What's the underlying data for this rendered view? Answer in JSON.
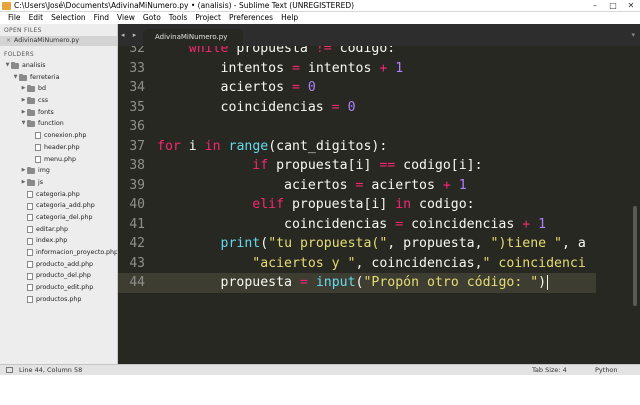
{
  "window": {
    "title": "C:\\Users\\José\\Documents\\AdivinaMiNumero.py • (analisis) - Sublime Text (UNREGISTERED)",
    "controls": [
      "–",
      "□",
      "✕"
    ]
  },
  "menu": [
    "File",
    "Edit",
    "Selection",
    "Find",
    "View",
    "Goto",
    "Tools",
    "Project",
    "Preferences",
    "Help"
  ],
  "sidebar": {
    "open_files_header": "OPEN FILES",
    "open_file": "AdivinaMiNumero.py",
    "folders_header": "FOLDERS",
    "tree": [
      {
        "label": "analisis",
        "type": "folder",
        "depth": 0,
        "expanded": true
      },
      {
        "label": "ferreteria",
        "type": "folder",
        "depth": 1,
        "expanded": true
      },
      {
        "label": "bd",
        "type": "folder",
        "depth": 2,
        "expanded": false
      },
      {
        "label": "css",
        "type": "folder",
        "depth": 2,
        "expanded": false
      },
      {
        "label": "fonts",
        "type": "folder",
        "depth": 2,
        "expanded": false
      },
      {
        "label": "function",
        "type": "folder",
        "depth": 2,
        "expanded": true
      },
      {
        "label": "conexion.php",
        "type": "file",
        "depth": 3
      },
      {
        "label": "header.php",
        "type": "file",
        "depth": 3
      },
      {
        "label": "menu.php",
        "type": "file",
        "depth": 3
      },
      {
        "label": "img",
        "type": "folder",
        "depth": 2,
        "expanded": false
      },
      {
        "label": "js",
        "type": "folder",
        "depth": 2,
        "expanded": false
      },
      {
        "label": "categoria.php",
        "type": "file",
        "depth": 2
      },
      {
        "label": "categoria_add.php",
        "type": "file",
        "depth": 2
      },
      {
        "label": "categoria_del.php",
        "type": "file",
        "depth": 2
      },
      {
        "label": "editar.php",
        "type": "file",
        "depth": 2
      },
      {
        "label": "index.php",
        "type": "file",
        "depth": 2
      },
      {
        "label": "informacion_proyecto.php",
        "type": "file",
        "depth": 2
      },
      {
        "label": "producto_add.php",
        "type": "file",
        "depth": 2
      },
      {
        "label": "producto_del.php",
        "type": "file",
        "depth": 2
      },
      {
        "label": "producto_edit.php",
        "type": "file",
        "depth": 2
      },
      {
        "label": "productos.php",
        "type": "file",
        "depth": 2
      }
    ]
  },
  "tabs": {
    "nav": "◂ ▸",
    "active_tab": "AdivinaMiNumero.py",
    "overflow": "▾"
  },
  "editor": {
    "current_line": 44,
    "lines": [
      {
        "n": "32",
        "tokens": [
          [
            "    ",
            ""
          ],
          [
            "while",
            "kw"
          ],
          [
            " propuesta ",
            ""
          ],
          [
            "!=",
            "kw"
          ],
          [
            " codigo:",
            ""
          ]
        ]
      },
      {
        "n": "33",
        "tokens": [
          [
            "        intentos ",
            ""
          ],
          [
            "=",
            "kw"
          ],
          [
            " intentos ",
            ""
          ],
          [
            "+",
            "kw"
          ],
          [
            " ",
            ""
          ],
          [
            "1",
            "num"
          ]
        ]
      },
      {
        "n": "34",
        "tokens": [
          [
            "        aciertos ",
            ""
          ],
          [
            "=",
            "kw"
          ],
          [
            " ",
            ""
          ],
          [
            "0",
            "num"
          ]
        ]
      },
      {
        "n": "35",
        "tokens": [
          [
            "        coincidencias ",
            ""
          ],
          [
            "=",
            "kw"
          ],
          [
            " ",
            ""
          ],
          [
            "0",
            "num"
          ]
        ]
      },
      {
        "n": "36",
        "tokens": []
      },
      {
        "n": "37",
        "tokens": [
          [
            "for",
            "kw"
          ],
          [
            " i ",
            ""
          ],
          [
            "in",
            "kw"
          ],
          [
            " ",
            ""
          ],
          [
            "range",
            "bi"
          ],
          [
            "(cant_digitos):",
            ""
          ]
        ]
      },
      {
        "n": "38",
        "tokens": [
          [
            "            ",
            ""
          ],
          [
            "if",
            "kw"
          ],
          [
            " propuesta[i] ",
            ""
          ],
          [
            "==",
            "kw"
          ],
          [
            " codigo[i]:",
            ""
          ]
        ]
      },
      {
        "n": "39",
        "tokens": [
          [
            "                aciertos ",
            ""
          ],
          [
            "=",
            "kw"
          ],
          [
            " aciertos ",
            ""
          ],
          [
            "+",
            "kw"
          ],
          [
            " ",
            ""
          ],
          [
            "1",
            "num"
          ]
        ]
      },
      {
        "n": "40",
        "tokens": [
          [
            "            ",
            ""
          ],
          [
            "elif",
            "kw"
          ],
          [
            " propuesta[i] ",
            ""
          ],
          [
            "in",
            "kw"
          ],
          [
            " codigo:",
            ""
          ]
        ]
      },
      {
        "n": "41",
        "tokens": [
          [
            "                coincidencias ",
            ""
          ],
          [
            "=",
            "kw"
          ],
          [
            " coincidencias ",
            ""
          ],
          [
            "+",
            "kw"
          ],
          [
            " ",
            ""
          ],
          [
            "1",
            "num"
          ]
        ]
      },
      {
        "n": "42",
        "tokens": [
          [
            "        ",
            ""
          ],
          [
            "print",
            "bi"
          ],
          [
            "(",
            ""
          ],
          [
            "\"tu propuesta(\"",
            "str"
          ],
          [
            ", propuesta, ",
            ""
          ],
          [
            "\")tiene \"",
            "str"
          ],
          [
            ", a",
            ""
          ]
        ]
      },
      {
        "n": "43",
        "tokens": [
          [
            "            ",
            ""
          ],
          [
            "\"aciertos y \"",
            "str"
          ],
          [
            ", coincidencias,",
            ""
          ],
          [
            "\" coincidenci",
            "str"
          ]
        ]
      },
      {
        "n": "44",
        "tokens": [
          [
            "        propuesta ",
            ""
          ],
          [
            "=",
            "kw"
          ],
          [
            " ",
            ""
          ],
          [
            "input",
            "bi"
          ],
          [
            "(",
            ""
          ],
          [
            "\"Propón otro código: \"",
            "str"
          ],
          [
            ")",
            ""
          ]
        ]
      }
    ]
  },
  "status": {
    "position": "Line 44, Column 58",
    "tab_size": "Tab Size: 4",
    "syntax": "Python"
  },
  "colors": {
    "editor_bg": "#272822",
    "keyword": "#f92672",
    "builtin": "#66d9ef",
    "number": "#ae81ff",
    "string": "#e6db74",
    "text": "#f8f8f2"
  }
}
